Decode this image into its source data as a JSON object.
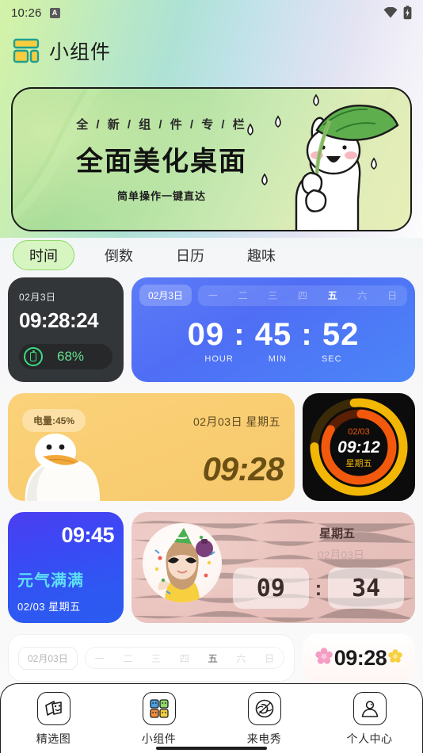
{
  "status_bar": {
    "time": "10:26",
    "app_badge": "A",
    "wifi_icon": "wifi-icon",
    "battery_icon": "battery-icon"
  },
  "header": {
    "logo_icon": "widget-grid-icon",
    "title": "小组件"
  },
  "banner": {
    "kicker": "全 / 新 / 组 / 件 / 专 / 栏",
    "headline": "全面美化桌面",
    "subtitle": "简单操作一键直达",
    "art": "rabbit-with-leaf-umbrella",
    "bg_start": "#b9e49a",
    "bg_end": "#e8eeb8"
  },
  "tabs": [
    {
      "label": "时间",
      "active": true
    },
    {
      "label": "倒数",
      "active": false
    },
    {
      "label": "日历",
      "active": false
    },
    {
      "label": "趣味",
      "active": false
    }
  ],
  "widgets": {
    "dark_clock": {
      "date": "02月3日",
      "time": "09:28:24",
      "battery_icon": "battery-icon",
      "battery_percent": "68%",
      "accent": "#3ddc7f",
      "bg": "#333639"
    },
    "blue_clock": {
      "date_badge": "02月3日",
      "weekdays": [
        "一",
        "二",
        "三",
        "四",
        "五",
        "六",
        "日"
      ],
      "active_weekday": "五",
      "hour": "09",
      "min": "45",
      "sec": "52",
      "separator": ":",
      "label_hour": "HOUR",
      "label_min": "MIN",
      "label_sec": "SEC",
      "bg": "#4f6ef5"
    },
    "duck_clock": {
      "battery_badge": "电量:45%",
      "date": "02月03日 星期五",
      "time": "09:28",
      "art": "white-duck",
      "bg": "#f9cd72"
    },
    "ring_clock": {
      "date": "02/03",
      "time": "09:12",
      "weekday": "星期五",
      "bg": "#0c0c0c",
      "ring_outer_color": "#f2b705",
      "ring_inner_color": "#f2590d"
    },
    "gradient_clock": {
      "time": "09:45",
      "slogan": "元气满满",
      "date": "02/03 星期五",
      "slogan_color": "#5ee0f5",
      "bg_start": "#4b3ef0",
      "bg_end": "#2a5cf0"
    },
    "pink_flip": {
      "weekday": "星期五",
      "date": "02月03日",
      "hour": "09",
      "min": "34",
      "separator": ":",
      "avatar": "party-girl-avatar",
      "bg": "#e9c2bd"
    },
    "white_week": {
      "date_badge": "02月03日",
      "weekdays": [
        "一",
        "二",
        "三",
        "四",
        "五",
        "六",
        "日"
      ],
      "active_weekday": "五"
    },
    "flower_clock": {
      "time": "09:28",
      "left_icon": "pink-flower-icon",
      "right_icon": "yellow-flower-icon"
    }
  },
  "bottom_nav": [
    {
      "label": "精选图",
      "icon": "masks-icon",
      "active": false
    },
    {
      "label": "小组件",
      "icon": "widget-grid-icon",
      "active": true
    },
    {
      "label": "来电秀",
      "icon": "call-show-icon",
      "active": false
    },
    {
      "label": "个人中心",
      "icon": "person-icon",
      "active": false
    }
  ]
}
